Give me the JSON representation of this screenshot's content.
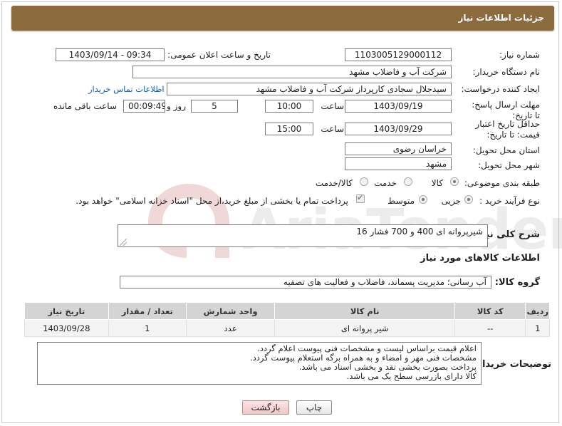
{
  "header": {
    "title": "جزئیات اطلاعات نیاز"
  },
  "form": {
    "need_number": {
      "label": "شماره نیاز:",
      "value": "1103005129000112"
    },
    "announce": {
      "label": "تاریخ و ساعت اعلان عمومی:",
      "value": "1403/09/14 - 09:34"
    },
    "buyer_org": {
      "label": "نام دستگاه خریدار:",
      "value": "شرکت آب و فاضلاب مشهد"
    },
    "requester": {
      "label": "ایجاد کننده درخواست:",
      "value": "سیدجلال سجادی کارپرداز شرکت آب و فاضلاب مشهد",
      "contact_link": "اطلاعات تماس خریدار"
    },
    "deadline": {
      "label": "مهلت ارسال پاسخ: تا تاریخ:",
      "date": "1403/09/19",
      "time_label": "ساعت",
      "time": "10:00",
      "days": "5",
      "days_label": "روز و",
      "remaining": "00:09:49",
      "remaining_label": "ساعت باقی مانده"
    },
    "validity": {
      "label": "حداقل تاریخ اعتبار قیمت: تا تاریخ:",
      "date": "1403/09/29",
      "time_label": "ساعت",
      "time": "15:00"
    },
    "province": {
      "label": "استان محل تحویل:",
      "value": "خراسان رضوی"
    },
    "city": {
      "label": "شهر محل تحویل:",
      "value": "مشهد"
    },
    "category": {
      "label": "طبقه بندی موضوعی:",
      "options": [
        "کالا",
        "خدمت",
        "کالا/خدمت"
      ],
      "selected": "کالا"
    },
    "purchase_type": {
      "label": "نوع فرآیند خرید :",
      "options": [
        "جزیی",
        "متوسط"
      ],
      "selected": "جزیی",
      "payment_note": "پرداخت تمام یا بخشی از مبلغ خرید،از محل \"اسناد خزانه اسلامی\" خواهد بود."
    },
    "description": {
      "label": "شرح کلی نیاز:",
      "value": "شیرپروانه ای 400 و 700 فشار 16"
    }
  },
  "goods": {
    "section_title": "اطلاعات کالاهای مورد نیاز",
    "group_label": "گروه کالا:",
    "group_value": "آب رسانی؛ مدیریت پسماند، فاضلاب و فعالیت های تصفیه",
    "columns": [
      "ردیف",
      "کد کالا",
      "نام کالا",
      "واحد شمارش",
      "تعداد / مقدار",
      "تاریخ نیاز"
    ],
    "rows": [
      {
        "row": "1",
        "code": "--",
        "name": "شیر پروانه ای",
        "unit": "عدد",
        "qty": "1",
        "date": "1403/09/28"
      }
    ]
  },
  "buyer_notes": {
    "label": "توضیحات خریدار:",
    "lines": [
      "اعلام قیمت براساس لیست و مشخصات فنی پیوست اعلام گردد.",
      "مشخصات فنی مهر و امضاء و به همراه برگه استعلام پیوست گردد.",
      "پرداخت بصورت بخشی نقد و بخشی اسناد می باشد.",
      "کالا دارای بازرسی سطح یک می باشد."
    ]
  },
  "buttons": {
    "print": "چاپ",
    "back": "بازگشت"
  },
  "watermark": {
    "text": "AriaTender.neT"
  }
}
